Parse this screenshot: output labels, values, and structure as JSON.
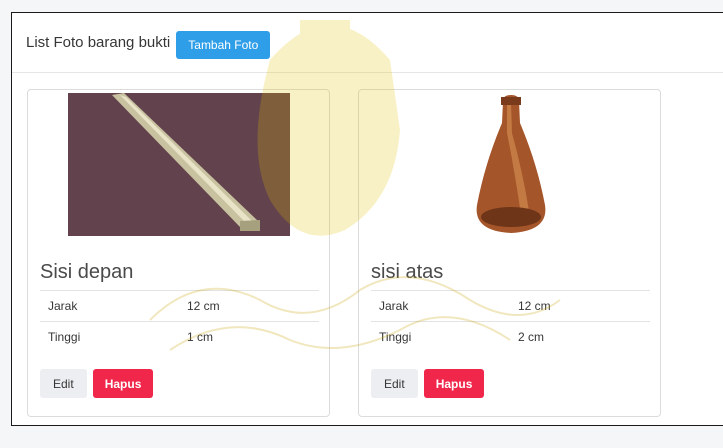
{
  "header": {
    "title": "List Foto barang bukti",
    "add_button_label": "Tambah Foto"
  },
  "cards": [
    {
      "title": "Sisi depan",
      "photo_icon": "photo-baton",
      "specs": [
        {
          "label": "Jarak",
          "value": "12 cm"
        },
        {
          "label": "Tinggi",
          "value": "1 cm"
        }
      ],
      "edit_label": "Edit",
      "delete_label": "Hapus"
    },
    {
      "title": "sisi atas",
      "photo_icon": "photo-wooden-bottle",
      "specs": [
        {
          "label": "Jarak",
          "value": "12 cm"
        },
        {
          "label": "Tinggi",
          "value": "2 cm"
        }
      ],
      "edit_label": "Edit",
      "delete_label": "Hapus"
    }
  ],
  "colors": {
    "primary": "#2f9ee9",
    "danger": "#f0264b",
    "light_button": "#eceef2",
    "watermark": "#e6c200"
  }
}
